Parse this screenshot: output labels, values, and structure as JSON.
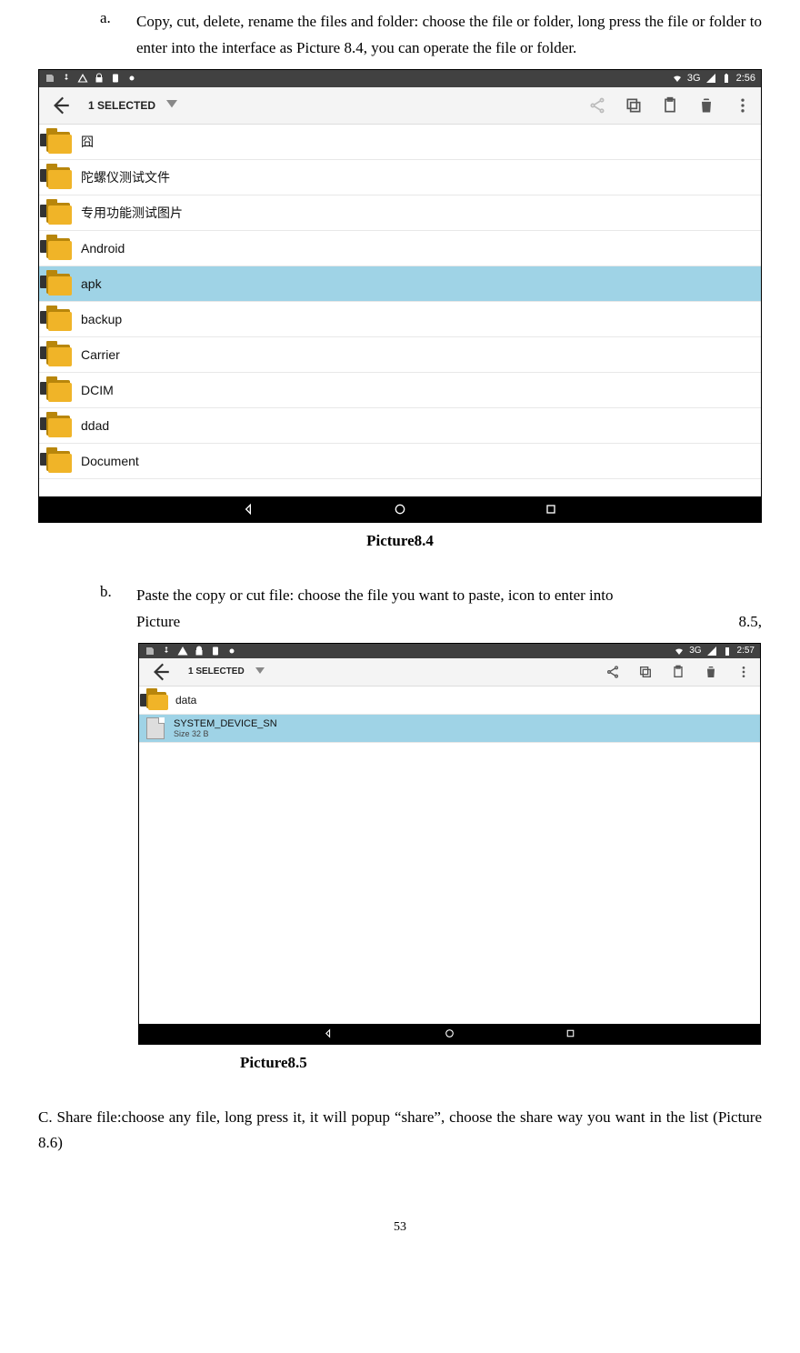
{
  "itemA": {
    "marker": "a.",
    "text": "Copy, cut, delete, rename the files and folder: choose the file or folder, long press the file or folder to enter into the interface as Picture 8.4, you can operate the file or folder."
  },
  "caption1": "Picture8.4",
  "itemB": {
    "marker": "b.",
    "line1_left": "Paste the copy or cut file: choose the file you want to paste, icon to enter into",
    "line2_left": "Picture",
    "line2_right": "8.5,"
  },
  "caption2": "Picture8.5",
  "paraC": "C. Share file:choose any file, long press it, it will popup “share”, choose the share way you want in the list (Picture 8.6)",
  "pageNum": "53",
  "shot1": {
    "status": {
      "net": "3G",
      "time": "2:56"
    },
    "toolbar": {
      "selected": "1 SELECTED"
    },
    "rows": [
      {
        "name": "囧",
        "sel": false
      },
      {
        "name": "陀螺仪测试文件",
        "sel": false
      },
      {
        "name": "专用功能测试图片",
        "sel": false
      },
      {
        "name": "Android",
        "sel": false
      },
      {
        "name": "apk",
        "sel": true
      },
      {
        "name": "backup",
        "sel": false
      },
      {
        "name": "Carrier",
        "sel": false
      },
      {
        "name": "DCIM",
        "sel": false
      },
      {
        "name": "ddad",
        "sel": false
      },
      {
        "name": "Document",
        "sel": false
      }
    ]
  },
  "shot2": {
    "status": {
      "net": "3G",
      "time": "2:57"
    },
    "toolbar": {
      "selected": "1 SELECTED"
    },
    "rows": [
      {
        "type": "folder",
        "name": "data",
        "sel": false
      },
      {
        "type": "file",
        "name": "SYSTEM_DEVICE_SN",
        "size": "Size 32 B",
        "sel": true
      }
    ]
  }
}
